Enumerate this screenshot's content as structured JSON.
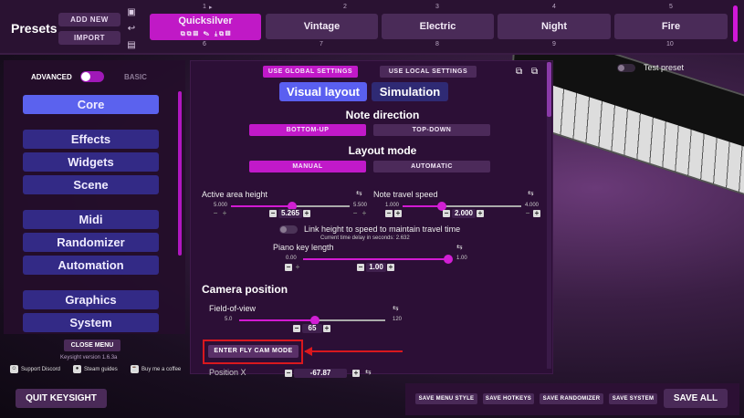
{
  "presets": {
    "title": "Presets",
    "add_new": "ADD NEW",
    "import": "IMPORT",
    "slots": [
      {
        "num": "1",
        "name": "Quicksilver"
      },
      {
        "num": "2",
        "name": "Vintage"
      },
      {
        "num": "3",
        "name": "Electric"
      },
      {
        "num": "4",
        "name": "Night"
      },
      {
        "num": "5",
        "name": "Fire"
      }
    ],
    "row2_nums": [
      "6",
      "7",
      "8",
      "9",
      "10"
    ]
  },
  "sidebar": {
    "advanced": "ADVANCED",
    "basic": "BASIC",
    "items": [
      "Core",
      "Effects",
      "Widgets",
      "Scene",
      "Midi",
      "Randomizer",
      "Automation",
      "Graphics",
      "System"
    ],
    "close_menu": "CLOSE MENU",
    "version": "Keysight version 1.6.3a",
    "links": [
      "Support Discord",
      "Steam guides",
      "Buy me a coffee"
    ]
  },
  "panel": {
    "use_global": "USE GLOBAL SETTINGS",
    "use_local": "USE LOCAL SETTINGS",
    "tab_visual": "Visual layout",
    "tab_sim": "Simulation",
    "note_direction": "Note direction",
    "bottom_up": "BOTTOM-UP",
    "top_down": "TOP-DOWN",
    "layout_mode": "Layout mode",
    "manual": "MANUAL",
    "automatic": "AUTOMATIC",
    "active_area": {
      "label": "Active area height",
      "min": "5.000",
      "max": "5.500",
      "value": "5.265",
      "fraction": 0.53
    },
    "travel_speed": {
      "label": "Note travel speed",
      "min": "1.000",
      "max": "4.000",
      "value": "2.000",
      "fraction": 0.33
    },
    "link_height": "Link height to speed to maintain travel time",
    "travel_delay": "Current time delay in seconds: 2.632",
    "piano_key": {
      "label": "Piano key length",
      "min": "0.00",
      "max": "1.00",
      "value": "1.00",
      "fraction": 1.0
    },
    "camera_position": "Camera position",
    "fov": {
      "label": "Field-of-view",
      "min": "5.0",
      "max": "120",
      "value": "65",
      "fraction": 0.52
    },
    "fly_cam": "ENTER FLY CAM MODE",
    "position_x": "Position X",
    "position_x_value": "-67.87"
  },
  "test_preset": "Test preset",
  "bottom": {
    "quit": "QUIT KEYSIGHT",
    "save_menu_style": "SAVE MENU STYLE",
    "save_hotkeys": "SAVE HOTKEYS",
    "save_randomizer": "SAVE RANDOMIZER",
    "save_system": "SAVE SYSTEM",
    "save_all": "SAVE ALL"
  },
  "colors": {
    "accent": "#c119c9",
    "nav": "#332a86",
    "nav_active": "#5b62ee",
    "highlight": "#d9181e"
  }
}
